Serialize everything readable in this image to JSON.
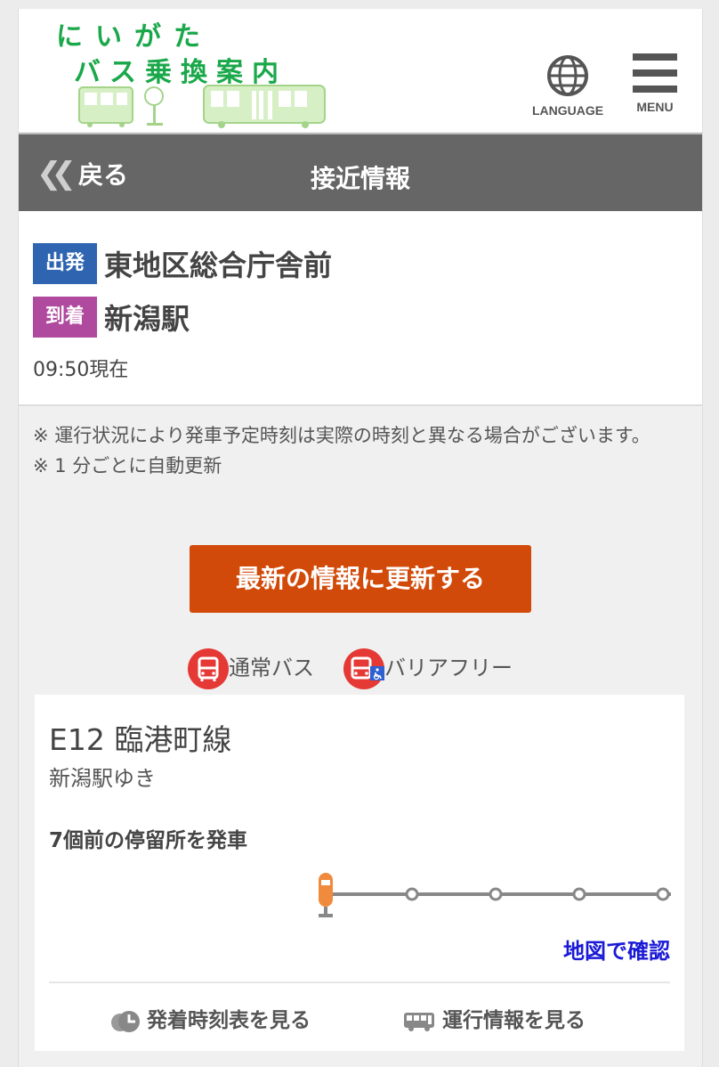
{
  "header": {
    "logo_line1": "にいがた",
    "logo_line2": "バス乗換案内",
    "language_label": "LANGUAGE",
    "menu_label": "MENU"
  },
  "titlebar": {
    "back_label": "戻る",
    "title": "接近情報"
  },
  "route": {
    "departure_tag": "出発",
    "departure_stop": "東地区総合庁舎前",
    "arrival_tag": "到着",
    "arrival_stop": "新潟駅",
    "as_of": "09:50現在"
  },
  "notes": {
    "note1": "※ 運行状況により発車予定時刻は実際の時刻と異なる場合がございます。",
    "note2": "※ 1 分ごとに自動更新"
  },
  "refresh_button": "最新の情報に更新する",
  "legend": {
    "normal_bus": "通常バス",
    "barrier_free": "バリアフリー"
  },
  "bus_card": {
    "line": "E12 臨港町線",
    "destination": "新潟駅ゆき",
    "status": "7個前の停留所を発車",
    "map_link": "地図で確認",
    "timetable_link": "発着時刻表を見る",
    "operation_link": "運行情報を見る"
  },
  "colors": {
    "logo_green": "#1aa84a",
    "titlebar": "#666666",
    "departure_tag": "#2e64b0",
    "arrival_tag": "#b04a9e",
    "refresh_button": "#d24a0a",
    "bus_red": "#e53935",
    "link_blue": "#1a1ad6"
  },
  "icons": [
    "globe-icon",
    "hamburger-menu-icon",
    "double-chevron-left-icon",
    "bus-icon",
    "wheelchair-bus-icon",
    "bus-stop-marker-icon",
    "clock-icon",
    "bus-side-icon"
  ]
}
